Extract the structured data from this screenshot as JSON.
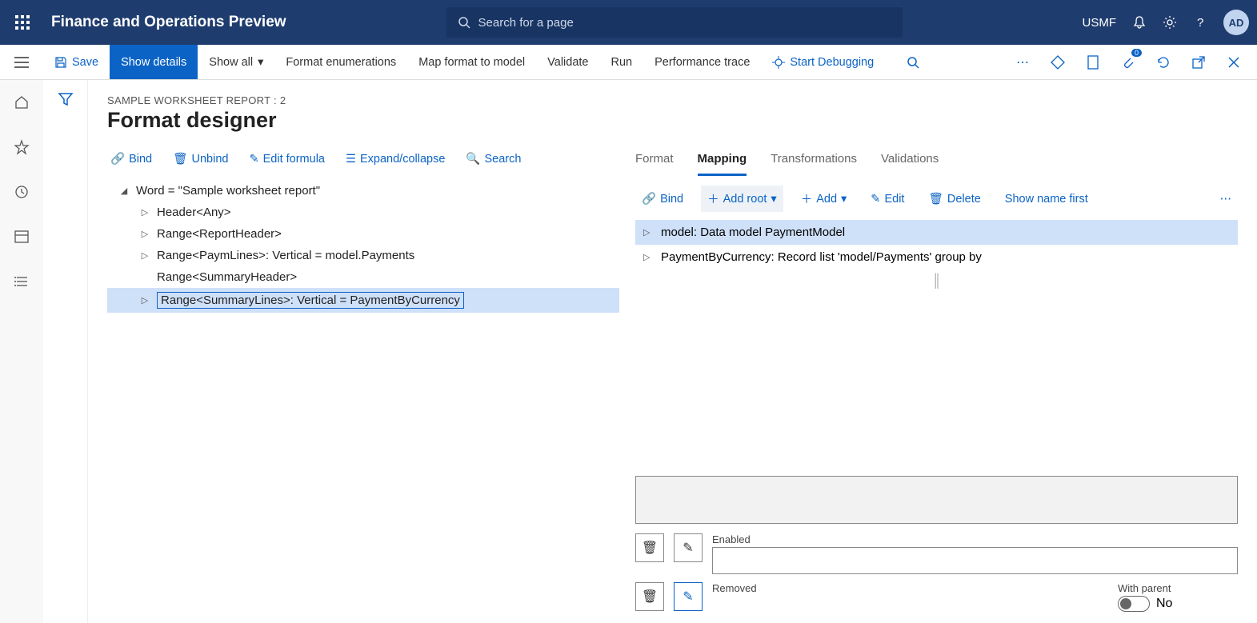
{
  "header": {
    "app_title": "Finance and Operations Preview",
    "search_placeholder": "Search for a page",
    "company": "USMF",
    "avatar_initials": "AD"
  },
  "cmdbar": {
    "save": "Save",
    "show_details": "Show details",
    "show_all": "Show all",
    "format_enum": "Format enumerations",
    "map_format": "Map format to model",
    "validate": "Validate",
    "run": "Run",
    "perf_trace": "Performance trace",
    "start_debug": "Start Debugging",
    "badge_count": "0"
  },
  "page": {
    "breadcrumb": "SAMPLE WORKSHEET REPORT : 2",
    "title": "Format designer"
  },
  "left_toolbar": {
    "bind": "Bind",
    "unbind": "Unbind",
    "edit_formula": "Edit formula",
    "expand": "Expand/collapse",
    "search": "Search"
  },
  "format_tree": {
    "root": "Word = \"Sample worksheet report\"",
    "items": [
      "Header<Any>",
      "Range<ReportHeader>",
      "Range<PaymLines>: Vertical = model.Payments",
      "Range<SummaryHeader>",
      "Range<SummaryLines>: Vertical = PaymentByCurrency"
    ]
  },
  "right_tabs": {
    "format": "Format",
    "mapping": "Mapping",
    "transformations": "Transformations",
    "validations": "Validations"
  },
  "map_toolbar": {
    "bind": "Bind",
    "add_root": "Add root",
    "add": "Add",
    "edit": "Edit",
    "delete": "Delete",
    "show_name_first": "Show name first"
  },
  "map_tree": {
    "items": [
      "model: Data model PaymentModel",
      "PaymentByCurrency: Record list 'model/Payments' group by"
    ]
  },
  "props": {
    "enabled_label": "Enabled",
    "removed_label": "Removed",
    "with_parent_label": "With parent",
    "with_parent_value": "No"
  }
}
